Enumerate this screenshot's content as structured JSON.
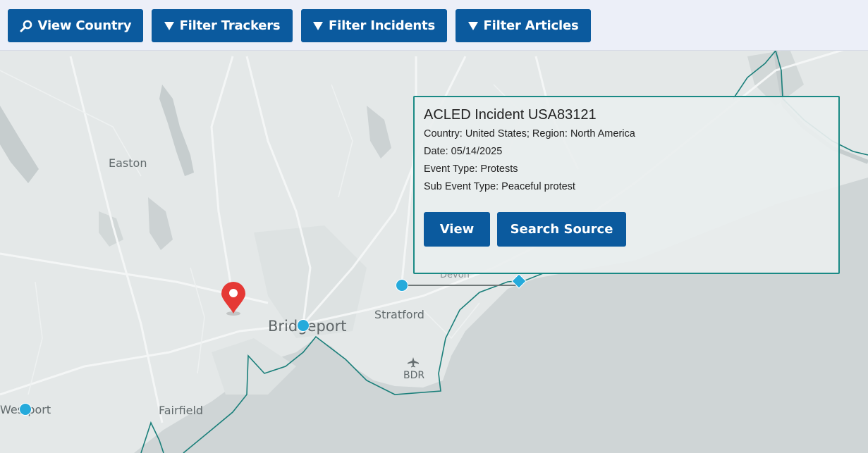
{
  "toolbar": {
    "view_country": "View Country",
    "filter_trackers": "Filter Trackers",
    "filter_incidents": "Filter Incidents",
    "filter_articles": "Filter Articles"
  },
  "map": {
    "labels": {
      "easton": "Easton",
      "bridgeport": "Bridgeport",
      "stratford": "Stratford",
      "fairfield": "Fairfield",
      "westport": "Westport",
      "devon": "Devon",
      "bdr": "BDR"
    }
  },
  "popup": {
    "title": "ACLED Incident USA83121",
    "country_line": "Country: United States; Region: North America",
    "date_line": "Date: 05/14/2025",
    "event_type_line": "Event Type: Protests",
    "sub_event_type_line": "Sub Event Type: Peaceful protest",
    "view_button": "View",
    "search_source_button": "Search Source"
  },
  "colors": {
    "button_blue": "#0b5a9e",
    "marker_cyan": "#25aadb",
    "pin_red": "#e53935",
    "boundary_teal": "#1a8a85",
    "water": "#cfd5d6",
    "land": "#e4e8e8"
  },
  "icons": {
    "view_country": "search-icon",
    "filters": "filter-icon",
    "pin": "map-pin-icon",
    "airport": "airplane-icon"
  }
}
